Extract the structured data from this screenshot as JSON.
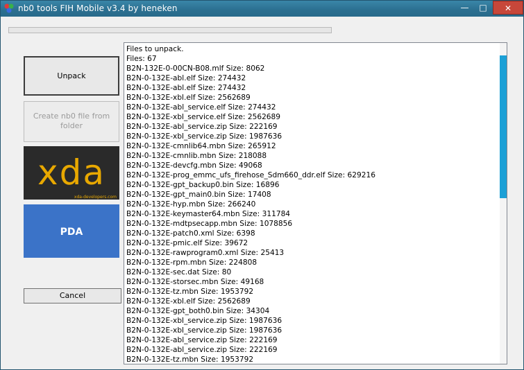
{
  "window": {
    "title": "nb0 tools FIH Mobile v3.4 by heneken",
    "minimize_label": "—",
    "maximize_label": "□",
    "close_label": "✕"
  },
  "progress": {
    "value_percent": 0
  },
  "buttons": {
    "unpack": "Unpack",
    "create_line1": "Create nb0 file from",
    "create_line2": "folder",
    "cancel": "Cancel"
  },
  "logos": {
    "xda_text": "xda",
    "xda_url": "xda-developers.com",
    "pda_text": "PDA"
  },
  "log": {
    "lines": [
      "Files to unpack.",
      "Files: 67",
      "B2N-132E-0-00CN-B08.mlf Size: 8062",
      "B2N-0-132E-abl.elf Size: 274432",
      "B2N-0-132E-abl.elf Size: 274432",
      "B2N-0-132E-xbl.elf Size: 2562689",
      "B2N-0-132E-abl_service.elf Size: 274432",
      "B2N-0-132E-xbl_service.elf Size: 2562689",
      "B2N-0-132E-abl_service.zip Size: 222169",
      "B2N-0-132E-xbl_service.zip Size: 1987636",
      "B2N-0-132E-cmnlib64.mbn Size: 265912",
      "B2N-0-132E-cmnlib.mbn Size: 218088",
      "B2N-0-132E-devcfg.mbn Size: 49068",
      "B2N-0-132E-prog_emmc_ufs_firehose_Sdm660_ddr.elf Size: 629216",
      "B2N-0-132E-gpt_backup0.bin Size: 16896",
      "B2N-0-132E-gpt_main0.bin Size: 17408",
      "B2N-0-132E-hyp.mbn Size: 266240",
      "B2N-0-132E-keymaster64.mbn Size: 311784",
      "B2N-0-132E-mdtpsecapp.mbn Size: 1078856",
      "B2N-0-132E-patch0.xml Size: 6398",
      "B2N-0-132E-pmic.elf Size: 39672",
      "B2N-0-132E-rawprogram0.xml Size: 25413",
      "B2N-0-132E-rpm.mbn Size: 224808",
      "B2N-0-132E-sec.dat Size: 80",
      "B2N-0-132E-storsec.mbn Size: 49168",
      "B2N-0-132E-tz.mbn Size: 1953792",
      "B2N-0-132E-xbl.elf Size: 2562689",
      "B2N-0-132E-gpt_both0.bin Size: 34304",
      "B2N-0-132E-xbl_service.zip Size: 1987636",
      "B2N-0-132E-xbl_service.zip Size: 1987636",
      "B2N-0-132E-abl_service.zip Size: 222169",
      "B2N-0-132E-abl_service.zip Size: 222169",
      "B2N-0-132E-tz.mbn Size: 1953792"
    ]
  },
  "colors": {
    "titlebar": "#2b6f90",
    "close_button": "#c7473a",
    "scroll_thumb": "#1ca0d6",
    "xda_accent": "#e8a800",
    "pda_blue": "#3b73c8"
  }
}
